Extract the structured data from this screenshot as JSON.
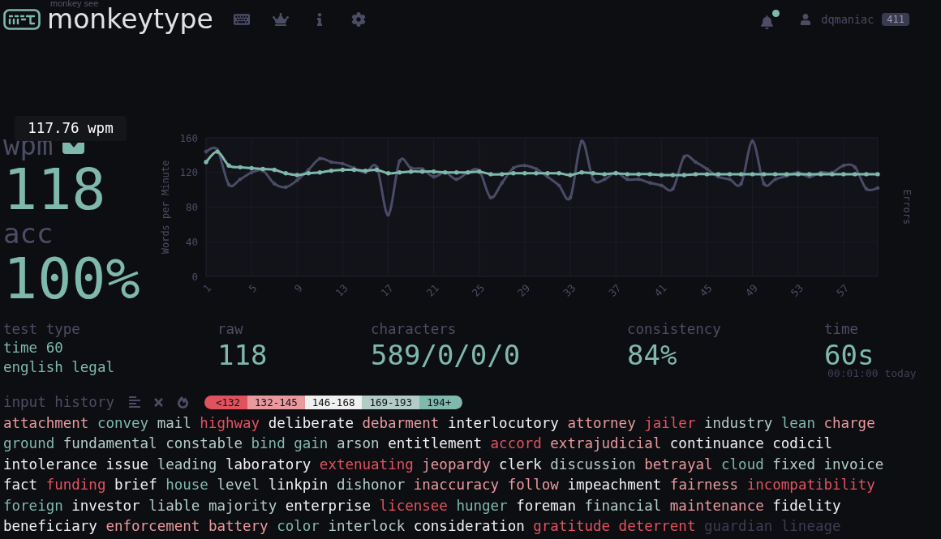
{
  "header": {
    "logo_caption": "monkey see",
    "logo_text": "monkeytype"
  },
  "notifications": {
    "unread": true
  },
  "account": {
    "username": "dqmaniac",
    "badge": "411"
  },
  "result": {
    "tooltip": "117.76 wpm",
    "wpm": {
      "label": "wpm",
      "value": "118",
      "personal_best": true
    },
    "acc": {
      "label": "acc",
      "value": "100%"
    }
  },
  "chart": {
    "right_axis_label": "Errors",
    "chart_data": {
      "type": "line",
      "ylabel": "Words per Minute",
      "grid": true,
      "x": [
        1,
        2,
        3,
        4,
        5,
        6,
        7,
        8,
        9,
        10,
        11,
        12,
        13,
        14,
        15,
        16,
        17,
        18,
        19,
        20,
        21,
        22,
        23,
        24,
        25,
        26,
        27,
        28,
        29,
        30,
        31,
        32,
        33,
        34,
        35,
        36,
        37,
        38,
        39,
        40,
        41,
        42,
        43,
        44,
        45,
        46,
        47,
        48,
        49,
        50,
        51,
        52,
        53,
        54,
        55,
        56,
        57,
        58,
        59,
        60
      ],
      "series": [
        {
          "color": "#4a4b67",
          "values": [
            144,
            146,
            106,
            112,
            120,
            122,
            107,
            103,
            111,
            123,
            136,
            132,
            130,
            125,
            120,
            126,
            71,
            133,
            125,
            124,
            115,
            120,
            112,
            120,
            122,
            91,
            108,
            125,
            128,
            124,
            115,
            105,
            91,
            156,
            112,
            112,
            120,
            112,
            112,
            108,
            105,
            101,
            138,
            132,
            124,
            115,
            112,
            107,
            156,
            107,
            112,
            116,
            120,
            115,
            120,
            120,
            128,
            126,
            101,
            102
          ]
        },
        {
          "color": "#7fb8ac",
          "values": [
            132,
            144,
            128,
            126,
            125,
            124,
            123,
            119,
            117,
            119,
            120,
            122,
            123,
            123,
            122,
            123,
            119,
            120,
            121,
            121,
            121,
            120,
            120,
            120,
            121,
            118,
            118,
            119,
            119,
            119,
            119,
            119,
            117,
            120,
            119,
            118,
            119,
            118,
            118,
            118,
            117,
            117,
            117,
            118,
            118,
            118,
            118,
            118,
            118,
            118,
            118,
            118,
            118,
            118,
            118,
            118,
            118,
            118,
            118,
            118
          ]
        }
      ],
      "xlim": [
        1,
        60
      ],
      "ylim": [
        0,
        160
      ],
      "xticks": [
        1,
        5,
        9,
        13,
        17,
        21,
        25,
        29,
        33,
        37,
        41,
        45,
        49,
        53,
        57
      ],
      "yticks": [
        0,
        40,
        80,
        120,
        160
      ]
    }
  },
  "stats": [
    {
      "kind": "text",
      "label": "test type",
      "lines": [
        "time 60",
        "english legal"
      ]
    },
    {
      "kind": "number",
      "label": "raw",
      "value": "118"
    },
    {
      "kind": "number",
      "label": "characters",
      "value": "589/0/0/0"
    },
    {
      "kind": "number",
      "label": "consistency",
      "value": "84%"
    },
    {
      "kind": "number",
      "label": "time",
      "value": "60s",
      "note": "00:01:00 today"
    }
  ],
  "input_history": {
    "label": "input history",
    "legend": [
      {
        "label": "<132",
        "color": "#e0525e"
      },
      {
        "label": "132-145",
        "color": "#e8999e"
      },
      {
        "label": "146-168",
        "color": "#f0f0f0"
      },
      {
        "label": "169-193",
        "color": "#b3ccc6"
      },
      {
        "label": "194+",
        "color": "#7fb8ac"
      }
    ],
    "words": [
      {
        "text": "attachment",
        "color": "#e8999e"
      },
      {
        "text": "convey",
        "color": "#7fb8ac"
      },
      {
        "text": "mail",
        "color": "#b3ccc6"
      },
      {
        "text": "highway",
        "color": "#e0525e"
      },
      {
        "text": "deliberate",
        "color": "#f0f0f0"
      },
      {
        "text": "debarment",
        "color": "#e8999e"
      },
      {
        "text": "interlocutory",
        "color": "#f0f0f0"
      },
      {
        "text": "attorney",
        "color": "#e8999e"
      },
      {
        "text": "jailer",
        "color": "#e0525e"
      },
      {
        "text": "industry",
        "color": "#b3ccc6"
      },
      {
        "text": "lean",
        "color": "#7fb8ac"
      },
      {
        "text": "charge",
        "color": "#e8999e"
      },
      {
        "text": "ground",
        "color": "#7fb8ac"
      },
      {
        "text": "fundamental",
        "color": "#b3ccc6"
      },
      {
        "text": "constable",
        "color": "#b3ccc6"
      },
      {
        "text": "bind",
        "color": "#7fb8ac"
      },
      {
        "text": "gain",
        "color": "#7fb8ac"
      },
      {
        "text": "arson",
        "color": "#b3ccc6"
      },
      {
        "text": "entitlement",
        "color": "#f0f0f0"
      },
      {
        "text": "accord",
        "color": "#e0525e"
      },
      {
        "text": "extrajudicial",
        "color": "#e8999e"
      },
      {
        "text": "continuance",
        "color": "#f0f0f0"
      },
      {
        "text": "codicil",
        "color": "#f0f0f0"
      },
      {
        "text": "intolerance",
        "color": "#f0f0f0"
      },
      {
        "text": "issue",
        "color": "#f0f0f0"
      },
      {
        "text": "leading",
        "color": "#b3ccc6"
      },
      {
        "text": "laboratory",
        "color": "#f0f0f0"
      },
      {
        "text": "extenuating",
        "color": "#e0525e"
      },
      {
        "text": "jeopardy",
        "color": "#e8999e"
      },
      {
        "text": "clerk",
        "color": "#f0f0f0"
      },
      {
        "text": "discussion",
        "color": "#b3ccc6"
      },
      {
        "text": "betrayal",
        "color": "#e8999e"
      },
      {
        "text": "cloud",
        "color": "#7fb8ac"
      },
      {
        "text": "fixed",
        "color": "#b3ccc6"
      },
      {
        "text": "invoice",
        "color": "#b3ccc6"
      },
      {
        "text": "fact",
        "color": "#f0f0f0"
      },
      {
        "text": "funding",
        "color": "#e0525e"
      },
      {
        "text": "brief",
        "color": "#f0f0f0"
      },
      {
        "text": "house",
        "color": "#7fb8ac"
      },
      {
        "text": "level",
        "color": "#b3ccc6"
      },
      {
        "text": "linkpin",
        "color": "#f0f0f0"
      },
      {
        "text": "dishonor",
        "color": "#b3ccc6"
      },
      {
        "text": "inaccuracy",
        "color": "#e8999e"
      },
      {
        "text": "follow",
        "color": "#e8999e"
      },
      {
        "text": "impeachment",
        "color": "#f0f0f0"
      },
      {
        "text": "fairness",
        "color": "#e8999e"
      },
      {
        "text": "incompatibility",
        "color": "#e0525e"
      },
      {
        "text": "foreign",
        "color": "#7fb8ac"
      },
      {
        "text": "investor",
        "color": "#f0f0f0"
      },
      {
        "text": "liable",
        "color": "#b3ccc6"
      },
      {
        "text": "majority",
        "color": "#b3ccc6"
      },
      {
        "text": "enterprise",
        "color": "#f0f0f0"
      },
      {
        "text": "licensee",
        "color": "#e0525e"
      },
      {
        "text": "hunger",
        "color": "#7fb8ac"
      },
      {
        "text": "foreman",
        "color": "#f0f0f0"
      },
      {
        "text": "financial",
        "color": "#b3ccc6"
      },
      {
        "text": "maintenance",
        "color": "#e8999e"
      },
      {
        "text": "fidelity",
        "color": "#f0f0f0"
      },
      {
        "text": "beneficiary",
        "color": "#f0f0f0"
      },
      {
        "text": "enforcement",
        "color": "#e8999e"
      },
      {
        "text": "battery",
        "color": "#e8999e"
      },
      {
        "text": "color",
        "color": "#7fb8ac"
      },
      {
        "text": "interlock",
        "color": "#b3ccc6"
      },
      {
        "text": "consideration",
        "color": "#f0f0f0"
      },
      {
        "text": "gratitude",
        "color": "#e0525e"
      },
      {
        "text": "deterrent",
        "color": "#e0525e"
      },
      {
        "text": "guardian",
        "color": "#3c3d53"
      },
      {
        "text": "lineage",
        "color": "#3c3d53"
      }
    ]
  }
}
